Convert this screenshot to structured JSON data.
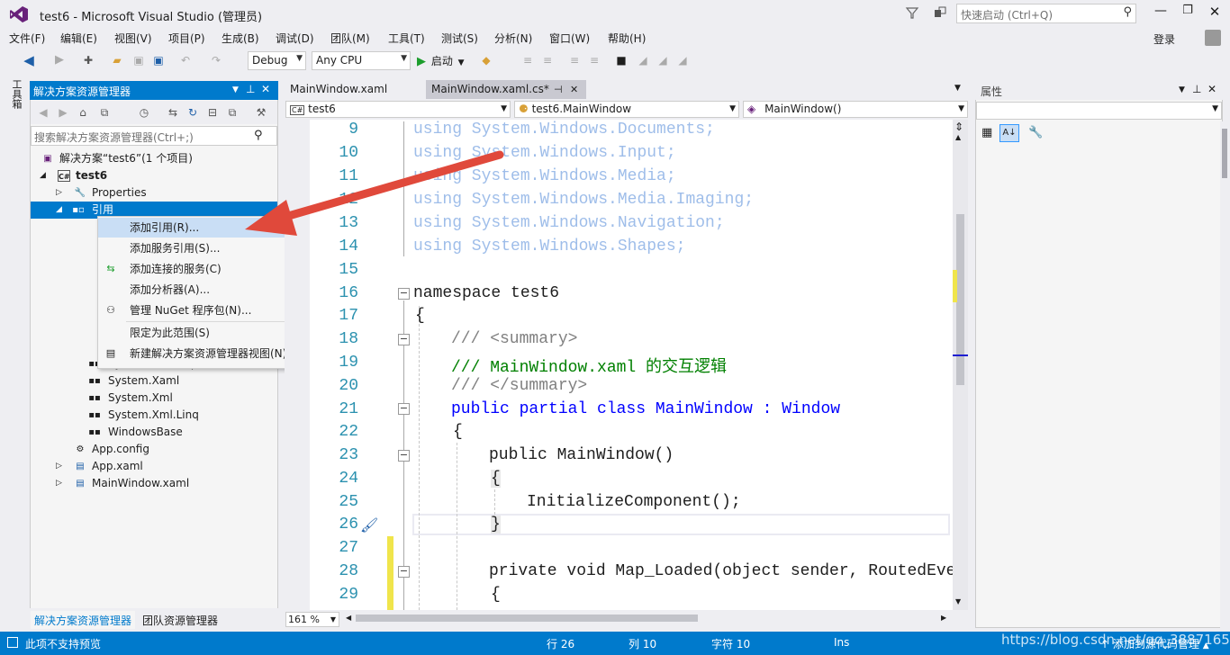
{
  "window": {
    "title": "test6 - Microsoft Visual Studio (管理员)",
    "quick_launch_placeholder": "快速启动 (Ctrl+Q)",
    "login": "登录"
  },
  "menu": [
    "文件(F)",
    "编辑(E)",
    "视图(V)",
    "项目(P)",
    "生成(B)",
    "调试(D)",
    "团队(M)",
    "工具(T)",
    "测试(S)",
    "分析(N)",
    "窗口(W)",
    "帮助(H)"
  ],
  "toolbar": {
    "config": "Debug",
    "platform": "Any CPU",
    "start_label": "启动"
  },
  "toolbox_tab": "工具箱",
  "solution_explorer": {
    "title": "解决方案资源管理器",
    "search_placeholder": "搜索解决方案资源管理器(Ctrl+;)",
    "solution_label": "解决方案“test6”(1 个项目)",
    "project": "test6",
    "properties": "Properties",
    "references": "引用",
    "ref_items": [
      "System.Net.Http",
      "System.Xaml",
      "System.Xml",
      "System.Xml.Linq",
      "WindowsBase"
    ],
    "files": [
      "App.config",
      "App.xaml",
      "MainWindow.xaml"
    ],
    "tabs": [
      "解决方案资源管理器",
      "团队资源管理器"
    ]
  },
  "context_menu": [
    {
      "label": "添加引用(R)...",
      "icon": "none"
    },
    {
      "label": "添加服务引用(S)...",
      "icon": "none"
    },
    {
      "label": "添加连接的服务(C)",
      "icon": "connected-service-icon"
    },
    {
      "label": "添加分析器(A)...",
      "icon": "none"
    },
    {
      "label": "管理 NuGet 程序包(N)...",
      "icon": "nuget-icon"
    },
    {
      "label": "限定为此范围(S)",
      "icon": "none"
    },
    {
      "label": "新建解决方案资源管理器视图(N)",
      "icon": "new-view-icon"
    }
  ],
  "editor": {
    "tabs": [
      "MainWindow.xaml",
      "MainWindow.xaml.cs*"
    ],
    "nav": [
      "test6",
      "test6.MainWindow",
      "MainWindow()"
    ],
    "zoom": "161 %",
    "lines": [
      {
        "n": "9",
        "text": "using System.Windows.Documents;"
      },
      {
        "n": "10",
        "text": "using System.Windows.Input;"
      },
      {
        "n": "11",
        "text": "using System.Windows.Media;"
      },
      {
        "n": "12",
        "text": "using System.Windows.Media.Imaging;"
      },
      {
        "n": "13",
        "text": "using System.Windows.Navigation;"
      },
      {
        "n": "14",
        "text": "using System.Windows.Shapes;"
      },
      {
        "n": "15",
        "text": ""
      },
      {
        "n": "16",
        "text": "namespace test6"
      },
      {
        "n": "17",
        "text": "{"
      },
      {
        "n": "18",
        "text": "/// <summary>"
      },
      {
        "n": "19",
        "text": "/// MainWindow.xaml 的交互逻辑"
      },
      {
        "n": "20",
        "text": "/// </summary>"
      },
      {
        "n": "21",
        "text": "public partial class MainWindow : Window"
      },
      {
        "n": "22",
        "text": "{"
      },
      {
        "n": "23",
        "text": "public MainWindow()"
      },
      {
        "n": "24",
        "text": "{"
      },
      {
        "n": "25",
        "text": "InitializeComponent();"
      },
      {
        "n": "26",
        "text": "}"
      },
      {
        "n": "27",
        "text": ""
      },
      {
        "n": "28",
        "text": "private void Map_Loaded(object sender, RoutedEven"
      },
      {
        "n": "29",
        "text": "{"
      }
    ]
  },
  "properties_panel": {
    "title": "属性"
  },
  "status": {
    "message": "此项不支持预览",
    "line": "行 26",
    "col": "列 10",
    "char": "字符 10",
    "mode": "Ins",
    "source_control": "添加到源代码管理"
  },
  "watermark": "https://blog.csdn.net/qq_38871652",
  "colors": {
    "accent": "#007acc",
    "arrow": "#e0493b",
    "keyword": "#0000ff",
    "type": "#2b91af",
    "comment": "#008000"
  }
}
